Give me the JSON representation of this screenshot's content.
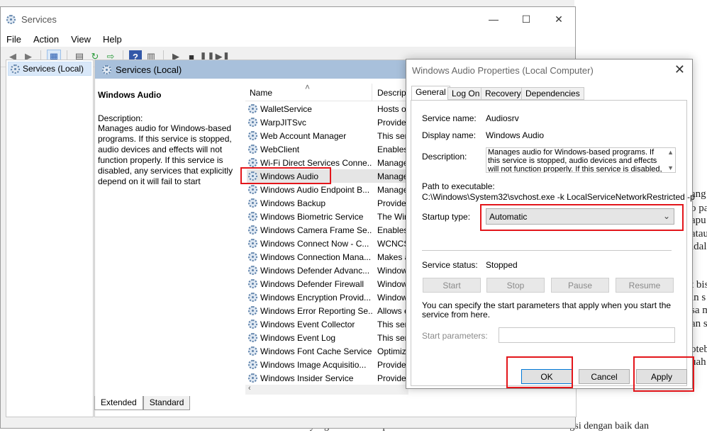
{
  "background_doc": {
    "lines": [
      "ang",
      "o pa",
      "apu",
      "atau",
      "idal",
      "t bis",
      "in s",
      "sa m",
      "an s",
      "oteb",
      "uah"
    ],
    "bottom_line": "cara yang terbaik. Jika pun cable kita audio device audio sudah berfungsi dengan baik dan"
  },
  "services_window": {
    "title": "Services",
    "controls": {
      "minimize": "—",
      "maximize": "☐",
      "close": "✕"
    },
    "menu": [
      "File",
      "Action",
      "View",
      "Help"
    ],
    "tree_root": "Services (Local)",
    "pane_header": "Services (Local)",
    "detail": {
      "name": "Windows Audio",
      "description_label": "Description:",
      "description": "Manages audio for Windows-based programs.  If this service is stopped, audio devices and effects will not function properly.  If this service is disabled, any services that explicitly depend on it will fail to start"
    },
    "columns": {
      "name": "Name",
      "description": "Descript"
    },
    "rows": [
      {
        "name": "WalletService",
        "desc": "Hosts o"
      },
      {
        "name": "WarpJITSvc",
        "desc": "Provide"
      },
      {
        "name": "Web Account Manager",
        "desc": "This ser"
      },
      {
        "name": "WebClient",
        "desc": "Enables"
      },
      {
        "name": "Wi-Fi Direct Services Conne...",
        "desc": "Manage"
      },
      {
        "name": "Windows Audio",
        "desc": "Manage"
      },
      {
        "name": "Windows Audio Endpoint B...",
        "desc": "Manage"
      },
      {
        "name": "Windows Backup",
        "desc": "Provide"
      },
      {
        "name": "Windows Biometric Service",
        "desc": "The Win"
      },
      {
        "name": "Windows Camera Frame Se...",
        "desc": "Enables"
      },
      {
        "name": "Windows Connect Now - C...",
        "desc": "WCNCS"
      },
      {
        "name": "Windows Connection Mana...",
        "desc": "Makes a"
      },
      {
        "name": "Windows Defender Advanc...",
        "desc": "Window"
      },
      {
        "name": "Windows Defender Firewall",
        "desc": "Window"
      },
      {
        "name": "Windows Encryption Provid...",
        "desc": "Window"
      },
      {
        "name": "Windows Error Reporting Se...",
        "desc": "Allows e"
      },
      {
        "name": "Windows Event Collector",
        "desc": "This ser"
      },
      {
        "name": "Windows Event Log",
        "desc": "This ser"
      },
      {
        "name": "Windows Font Cache Service",
        "desc": "Optimiz"
      },
      {
        "name": "Windows Image Acquisitio...",
        "desc": "Provide"
      },
      {
        "name": "Windows Insider Service",
        "desc": "Provide"
      }
    ],
    "tabs": [
      "Extended",
      "Standard"
    ]
  },
  "dialog": {
    "title": "Windows Audio Properties (Local Computer)",
    "close": "✕",
    "tabs": [
      "General",
      "Log On",
      "Recovery",
      "Dependencies"
    ],
    "service_name_label": "Service name:",
    "service_name": "Audiosrv",
    "display_name_label": "Display name:",
    "display_name": "Windows Audio",
    "description_label": "Description:",
    "description": "Manages audio for Windows-based programs.  If this service is stopped, audio devices and effects will not function properly.  If this service is disabled, any",
    "path_label": "Path to executable:",
    "path": "C:\\Windows\\System32\\svchost.exe -k LocalServiceNetworkRestricted -p",
    "startup_label": "Startup type:",
    "startup_value": "Automatic",
    "status_label": "Service status:",
    "status_value": "Stopped",
    "buttons_service": {
      "start": "Start",
      "stop": "Stop",
      "pause": "Pause",
      "resume": "Resume"
    },
    "params_note": "You can specify the start parameters that apply when you start the service from here.",
    "params_label": "Start parameters:",
    "buttons": {
      "ok": "OK",
      "cancel": "Cancel",
      "apply": "Apply"
    }
  }
}
